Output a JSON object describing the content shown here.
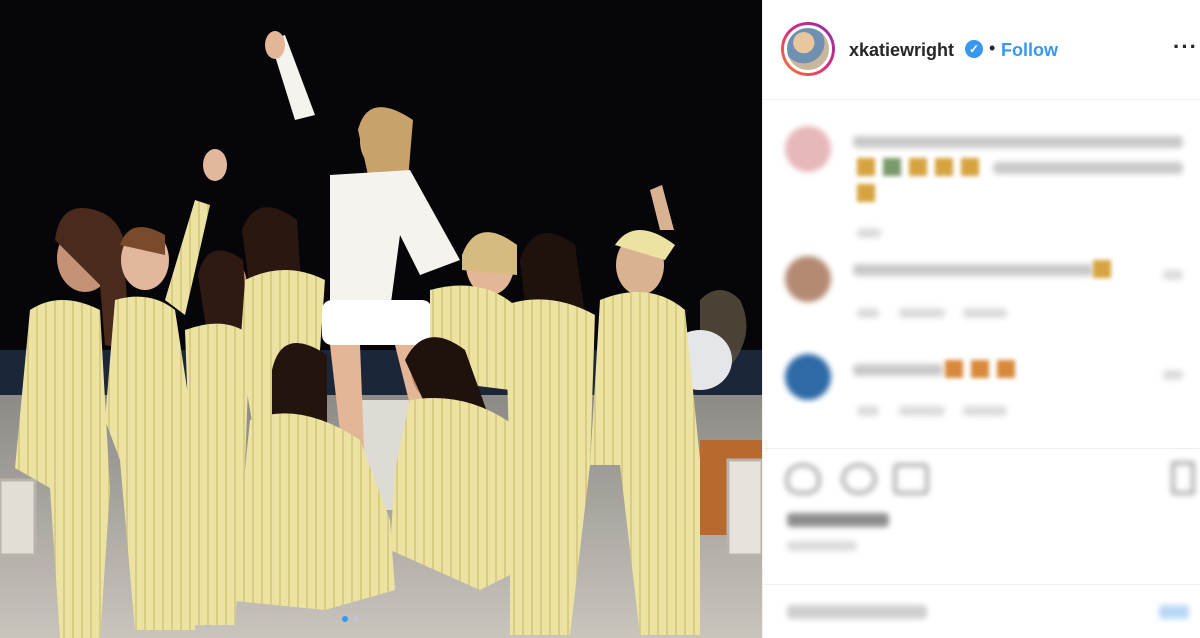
{
  "post": {
    "username": "xkatiewright",
    "verified_mark": "✓",
    "separator": "•",
    "follow_label": "Follow",
    "more_label": "···"
  },
  "carousel": {
    "total": 2,
    "active": 1
  },
  "colors": {
    "follow_blue": "#3897f0",
    "username_dark": "#262626",
    "photo_background": "#06060a",
    "pajama_yellow": "#ece3a2"
  },
  "icons": [
    "verified-badge-icon",
    "more-options-icon",
    "like-icon",
    "comment-icon",
    "share-icon",
    "save-bookmark-icon"
  ]
}
